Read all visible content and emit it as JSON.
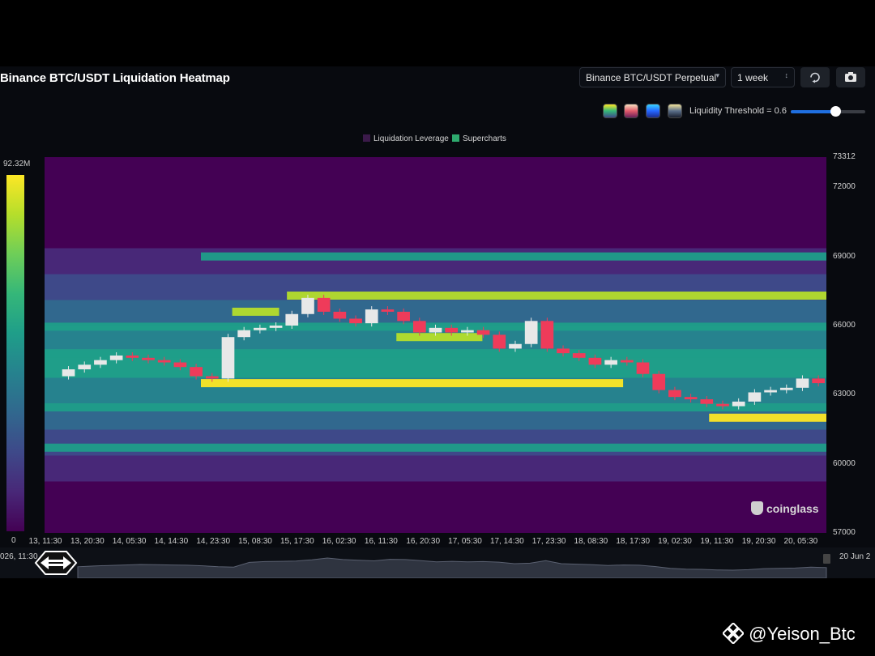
{
  "header": {
    "title": "Binance BTC/USDT Liquidation Heatmap",
    "pair_select": "Binance BTC/USDT Perpetual",
    "range_select": "1 week",
    "threshold_label": "Liquidity Threshold = 0.6"
  },
  "colors": {
    "accent": "#1f6fe0",
    "colorscale": [
      "#440154",
      "#482878",
      "#3e4989",
      "#31688e",
      "#26828e",
      "#1f9e89",
      "#35b779",
      "#6ece58",
      "#b5de2b",
      "#fde725"
    ],
    "candle_up": "#e8e8e8",
    "candle_down": "#ef3b5a",
    "legend_liq": "#3b1a4a",
    "legend_super": "#2eaa6e"
  },
  "icons": [
    "refresh-icon",
    "camera-icon",
    "coinglass-logo",
    "binance-square-icon"
  ],
  "colorbar": {
    "max_label": "92.32M",
    "min_label": "0"
  },
  "navigator": {
    "left_label": "026, 11:30",
    "right_label": "20 Jun 2"
  },
  "watermark": "coinglass",
  "credit": "@Yeison_Btc",
  "chart_data": {
    "type": "heatmap",
    "title": "Binance BTC/USDT Liquidation Heatmap",
    "legend": [
      "Liquidation Leverage",
      "Supercharts"
    ],
    "ylim": [
      57000,
      73312
    ],
    "y_ticks": [
      "73312",
      "72000",
      "69000",
      "66000",
      "63000",
      "60000",
      "57000"
    ],
    "x_ticks": [
      "13, 11:30",
      "13, 20:30",
      "14, 05:30",
      "14, 14:30",
      "14, 23:30",
      "15, 08:30",
      "15, 17:30",
      "16, 02:30",
      "16, 11:30",
      "16, 20:30",
      "17, 05:30",
      "17, 14:30",
      "17, 23:30",
      "18, 08:30",
      "18, 17:30",
      "19, 02:30",
      "19, 11:30",
      "19, 20:30",
      "20, 05:30"
    ],
    "price_path": [
      [
        0,
        63800
      ],
      [
        1,
        64100
      ],
      [
        2,
        64300
      ],
      [
        3,
        64500
      ],
      [
        4,
        64700
      ],
      [
        5,
        64600
      ],
      [
        6,
        64500
      ],
      [
        7,
        64400
      ],
      [
        8,
        64200
      ],
      [
        9,
        63800
      ],
      [
        10,
        63700
      ],
      [
        11,
        65500
      ],
      [
        12,
        65800
      ],
      [
        13,
        65900
      ],
      [
        14,
        66000
      ],
      [
        15,
        66500
      ],
      [
        16,
        67200
      ],
      [
        17,
        66600
      ],
      [
        18,
        66300
      ],
      [
        19,
        66100
      ],
      [
        20,
        66700
      ],
      [
        21,
        66600
      ],
      [
        22,
        66200
      ],
      [
        23,
        65700
      ],
      [
        24,
        65900
      ],
      [
        25,
        65700
      ],
      [
        26,
        65800
      ],
      [
        27,
        65600
      ],
      [
        28,
        65000
      ],
      [
        29,
        65200
      ],
      [
        30,
        66200
      ],
      [
        31,
        65000
      ],
      [
        32,
        64800
      ],
      [
        33,
        64600
      ],
      [
        34,
        64300
      ],
      [
        35,
        64500
      ],
      [
        36,
        64400
      ],
      [
        37,
        63900
      ],
      [
        38,
        63200
      ],
      [
        39,
        62900
      ],
      [
        40,
        62800
      ],
      [
        41,
        62600
      ],
      [
        42,
        62500
      ],
      [
        43,
        62700
      ],
      [
        44,
        63100
      ],
      [
        45,
        63200
      ],
      [
        46,
        63300
      ],
      [
        47,
        63700
      ],
      [
        48,
        63500
      ]
    ],
    "liquidation_levels": [
      {
        "price": 67300,
        "intensity": 0.9,
        "from": 0.31,
        "to": 1.0
      },
      {
        "price": 66600,
        "intensity": 0.85,
        "from": 0.24,
        "to": 0.3
      },
      {
        "price": 65950,
        "intensity": 0.6,
        "from": 0.0,
        "to": 1.0
      },
      {
        "price": 65500,
        "intensity": 0.85,
        "from": 0.45,
        "to": 0.56
      },
      {
        "price": 64800,
        "intensity": 0.55,
        "from": 0.0,
        "to": 1.0
      },
      {
        "price": 63500,
        "intensity": 1.0,
        "from": 0.2,
        "to": 0.74
      },
      {
        "price": 62450,
        "intensity": 0.5,
        "from": 0.0,
        "to": 1.0
      },
      {
        "price": 62000,
        "intensity": 1.0,
        "from": 0.85,
        "to": 1.0
      },
      {
        "price": 69000,
        "intensity": 0.55,
        "from": 0.2,
        "to": 1.0
      },
      {
        "price": 60700,
        "intensity": 0.5,
        "from": 0.0,
        "to": 1.0
      }
    ]
  }
}
